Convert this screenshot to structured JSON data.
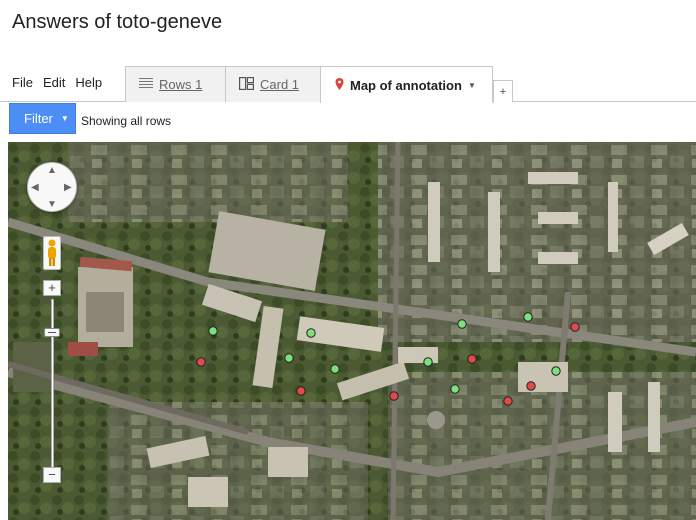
{
  "page": {
    "title": "Answers of toto-geneve"
  },
  "menu": {
    "file": "File",
    "edit": "Edit",
    "help": "Help"
  },
  "tabs": {
    "rows": {
      "label": "Rows 1",
      "icon": "table-rows-icon"
    },
    "card": {
      "label": "Card 1",
      "icon": "card-view-icon"
    },
    "map": {
      "label": "Map of annotation",
      "icon": "map-pin-icon",
      "accent": "#d9453d"
    },
    "add": {
      "label": "+"
    }
  },
  "filter": {
    "button_label": "Filter",
    "status": "Showing all rows",
    "button_color": "#4c8ef5"
  },
  "map_controls": {
    "zoom_in": "+",
    "zoom_out": "−",
    "pan_icon": "pan-arrows-icon",
    "streetview_icon": "pegman-icon"
  },
  "markers": {
    "green_color": "#7ee07a",
    "red_color": "#e04a4a",
    "items": [
      {
        "color": "green"
      },
      {
        "color": "green"
      },
      {
        "color": "green"
      },
      {
        "color": "green"
      },
      {
        "color": "green"
      },
      {
        "color": "green"
      },
      {
        "color": "green"
      },
      {
        "color": "green"
      },
      {
        "color": "green"
      },
      {
        "color": "red"
      },
      {
        "color": "red"
      },
      {
        "color": "red"
      },
      {
        "color": "red"
      },
      {
        "color": "red"
      },
      {
        "color": "red"
      },
      {
        "color": "red"
      }
    ]
  }
}
